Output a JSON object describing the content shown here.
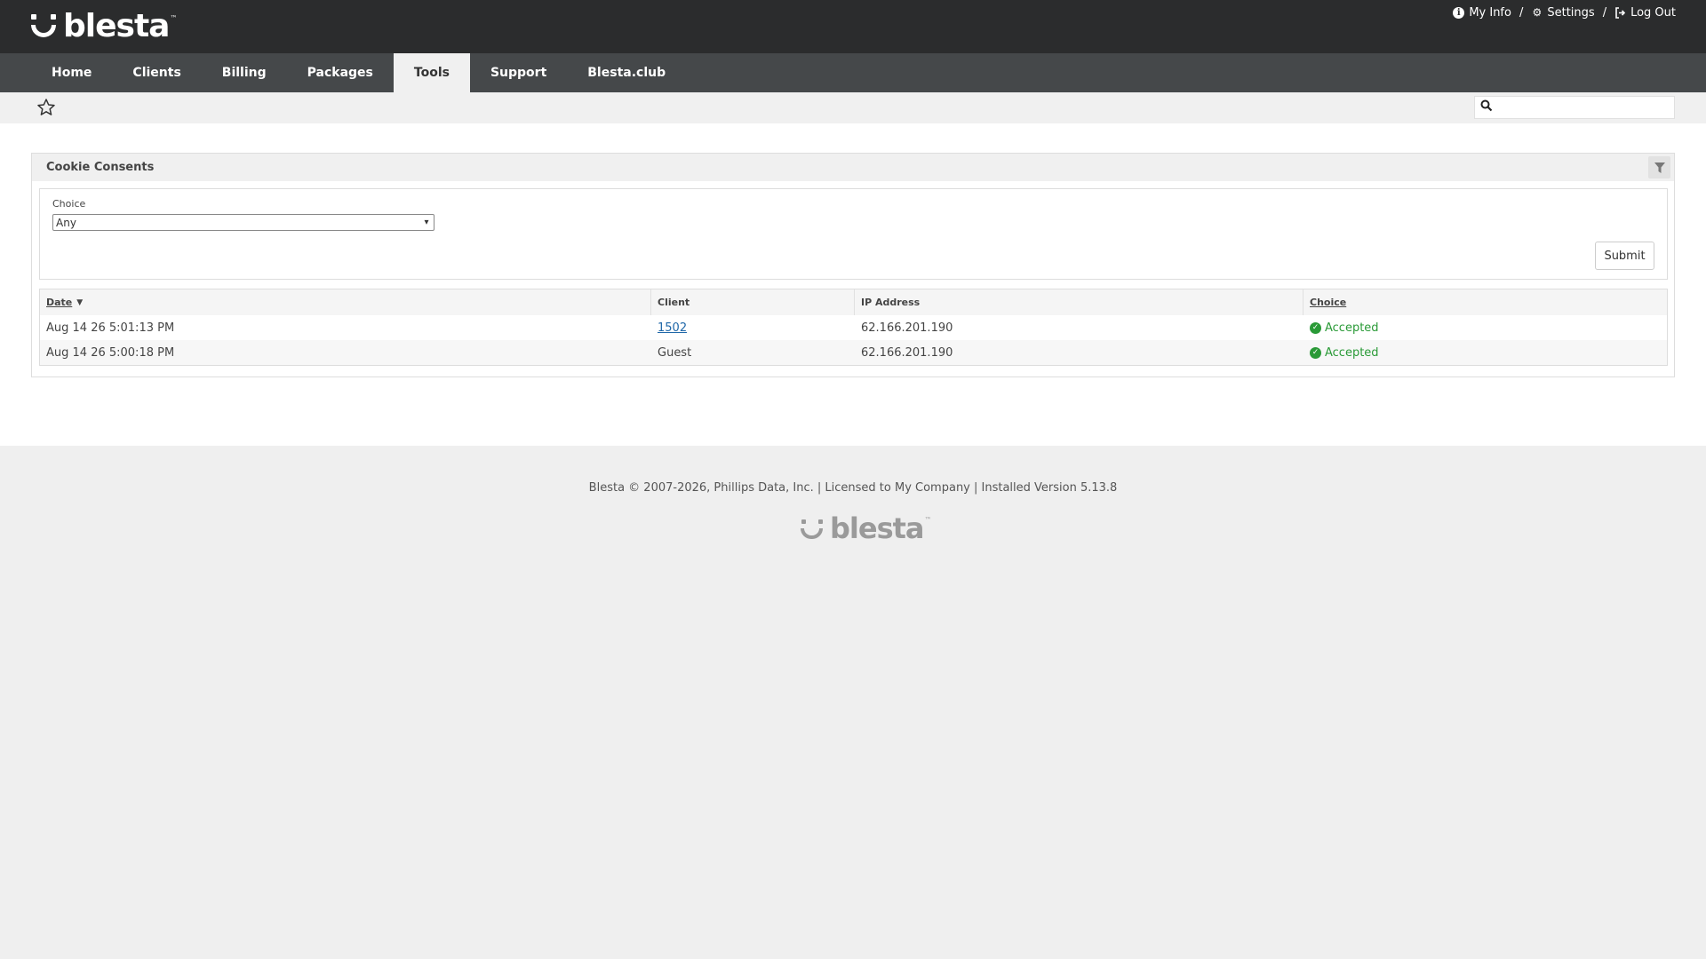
{
  "brand": {
    "name": "blesta",
    "tm": "™"
  },
  "topnav": {
    "myinfo": "My Info",
    "settings": "Settings",
    "logout": "Log Out",
    "sep": "/"
  },
  "mainnav": [
    "Home",
    "Clients",
    "Billing",
    "Packages",
    "Tools",
    "Support",
    "Blesta.club"
  ],
  "active_tab": "Tools",
  "search": {
    "placeholder": "",
    "value": ""
  },
  "panel": {
    "title": "Cookie Consents",
    "filter": {
      "label": "Choice",
      "selected": "Any"
    },
    "submit_label": "Submit"
  },
  "table": {
    "headers": {
      "date": "Date",
      "client": "Client",
      "ip": "IP Address",
      "choice": "Choice"
    },
    "rows": [
      {
        "date": "Aug 14 26 5:01:13 PM",
        "client": "1502",
        "ip": "62.166.201.190",
        "choice": "Accepted"
      },
      {
        "date": "Aug 14 26 5:00:18 PM",
        "client": "Guest",
        "ip": "62.166.201.190",
        "choice": "Accepted"
      }
    ]
  },
  "footer": {
    "text": "Blesta © 2007-2026, Phillips Data, Inc. | Licensed to My Company | Installed Version 5.13.8",
    "logo": "blesta",
    "tm": "™"
  },
  "colors": {
    "header": "#2b2c2d",
    "nav": "#45484a",
    "accepted": "#2a9a37",
    "link": "#1f67a8"
  },
  "icons": {
    "myinfo": "info-circle-icon",
    "settings": "gear-icon",
    "logout": "sign-out-icon",
    "star": "star-outline-icon",
    "search": "search-icon",
    "filter": "filter-icon",
    "check": "check-circle-icon"
  }
}
